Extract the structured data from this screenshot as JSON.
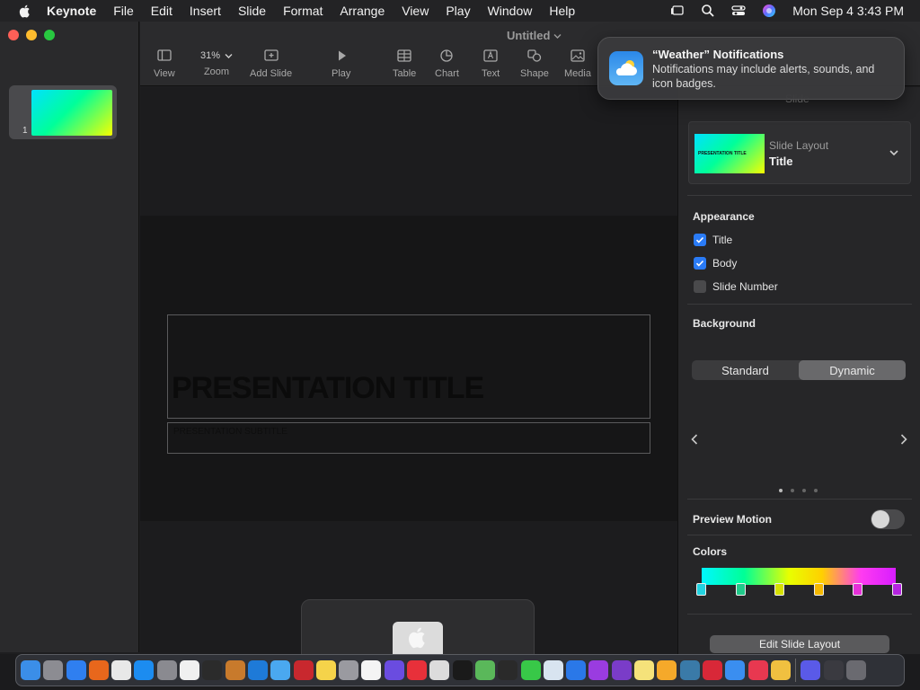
{
  "menubar": {
    "app_name": "Keynote",
    "items": [
      "File",
      "Edit",
      "Insert",
      "Slide",
      "Format",
      "Arrange",
      "View",
      "Play",
      "Window",
      "Help"
    ],
    "datetime": "Mon Sep 4  3:43 PM"
  },
  "document": {
    "title": "Untitled"
  },
  "toolbar": {
    "view_label": "View",
    "zoom_value": "31%",
    "zoom_label": "Zoom",
    "add_slide_label": "Add Slide",
    "play_label": "Play",
    "table_label": "Table",
    "chart_label": "Chart",
    "text_label": "Text",
    "shape_label": "Shape",
    "media_label": "Media"
  },
  "navigator": {
    "slide_number": "1"
  },
  "slide": {
    "title": "PRESENTATION TITLE",
    "subtitle": "PRESENTATION SUBTITLE"
  },
  "inspector": {
    "tab": "Slide",
    "layout_label": "Slide Layout",
    "layout_value": "Title",
    "layout_thumb_text": "PRESENTATION TITLE",
    "appearance_title": "Appearance",
    "checkboxes": [
      {
        "label": "Title",
        "checked": true
      },
      {
        "label": "Body",
        "checked": true
      },
      {
        "label": "Slide Number",
        "checked": false
      }
    ],
    "background_title": "Background",
    "background_options": [
      "Standard",
      "Dynamic"
    ],
    "background_selected": "Dynamic",
    "preview_motion_label": "Preview Motion",
    "preview_motion_on": false,
    "colors_title": "Colors",
    "color_stops": [
      "#22d3e0",
      "#20c98a",
      "#d6e000",
      "#f5b800",
      "#e530d8",
      "#b524e0"
    ],
    "edit_layout_button": "Edit Slide Layout"
  },
  "notification": {
    "title": "“Weather” Notifications",
    "body": "Notifications may include alerts, sounds, and icon badges."
  },
  "dock": {
    "icons": [
      "finder-icon",
      "launchpad-icon",
      "safari-icon",
      "firefox-icon",
      "chrome-icon",
      "app-store-icon",
      "system-settings-icon",
      "textedit-icon",
      "terminal-icon",
      "instruments-icon",
      "vscode-icon",
      "weather-icon",
      "voice-memos-icon",
      "notes-icon",
      "screenshot-icon",
      "reminders-icon",
      "shortcuts-icon",
      "news-icon",
      "font-book-icon",
      "apple-tv-icon",
      "maps-icon",
      "activity-icon",
      "messages-icon",
      "preview-icon",
      "keynote-icon",
      "podcasts-icon",
      "visual-studio-icon",
      "notes-yellow-icon",
      "home-icon",
      "quicktime-icon",
      "toolbox-icon",
      "mail-icon",
      "music-icon",
      "photos-icon",
      "system-info-icon",
      "keyboard-icon",
      "trash-icon"
    ],
    "colors": [
      "#3b8ee8",
      "#8c8c92",
      "#2f7ff0",
      "#e8671c",
      "#e8e8e8",
      "#1c8cf0",
      "#8a8a90",
      "#f0f0f0",
      "#2b2b2b",
      "#c87a2c",
      "#1e7ad8",
      "#4aa8f0",
      "#c8282e",
      "#f5d34a",
      "#9a9aa0",
      "#f4f4f4",
      "#6a4ce0",
      "#e8303a",
      "#dcdcdc",
      "#1a1a1a",
      "#5ab85a",
      "#2a2a2a",
      "#38c848",
      "#d8e4f0",
      "#2a78e8",
      "#9a3ce0",
      "#7a3cc8",
      "#f5e27a",
      "#f5a92a",
      "#3a7aa8",
      "#d82838",
      "#3a8ef0",
      "#e83850",
      "#f0c040",
      "#5a5ae8",
      "#3a3a40",
      "#6a6a70"
    ]
  }
}
